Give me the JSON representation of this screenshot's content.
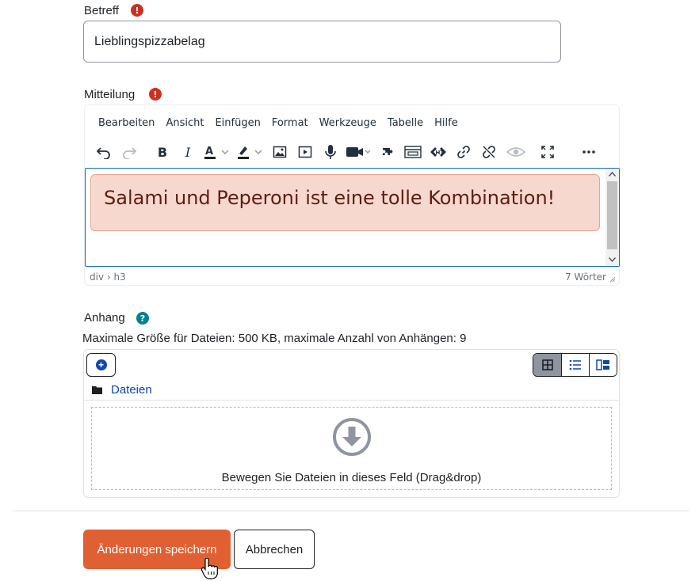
{
  "subject": {
    "label": "Betreff",
    "required_icon": "exclamation-icon",
    "value": "Lieblingspizzabelag"
  },
  "message": {
    "label": "Mitteilung",
    "required_icon": "exclamation-icon",
    "menus": [
      "Bearbeiten",
      "Ansicht",
      "Einfügen",
      "Format",
      "Werkzeuge",
      "Tabelle",
      "Hilfe"
    ],
    "toolbar_icons": [
      "undo-icon",
      "redo-icon",
      "bold-icon",
      "italic-icon",
      "text-color-icon",
      "highlight-color-icon",
      "image-icon",
      "media-icon",
      "record-audio-icon",
      "record-video-icon",
      "h5p-icon",
      "embed-icon",
      "accessibility-checker-icon",
      "link-icon",
      "unlink-icon",
      "preview-icon",
      "fullscreen-icon",
      "more-icon"
    ],
    "content": "Salami und Peperoni ist eine tolle Kombination!",
    "content_bg": "#f7d8cf",
    "path": "div › h3",
    "word_count": "7 Wörter"
  },
  "attachment": {
    "label": "Anhang",
    "help_icon": "question-icon",
    "limits": "Maximale Größe für Dateien: 500 KB, maximale Anzahl von Anhängen: 9",
    "folder_label": "Dateien",
    "drop_text": "Bewegen Sie Dateien in dieses Feld (Drag&drop)",
    "view_modes": [
      "grid-view-icon",
      "list-view-icon",
      "tree-view-icon"
    ],
    "active_view": "grid-view-icon"
  },
  "actions": {
    "save_label": "Änderungen speichern",
    "cancel_label": "Abbrechen",
    "primary_color": "#e06033"
  }
}
